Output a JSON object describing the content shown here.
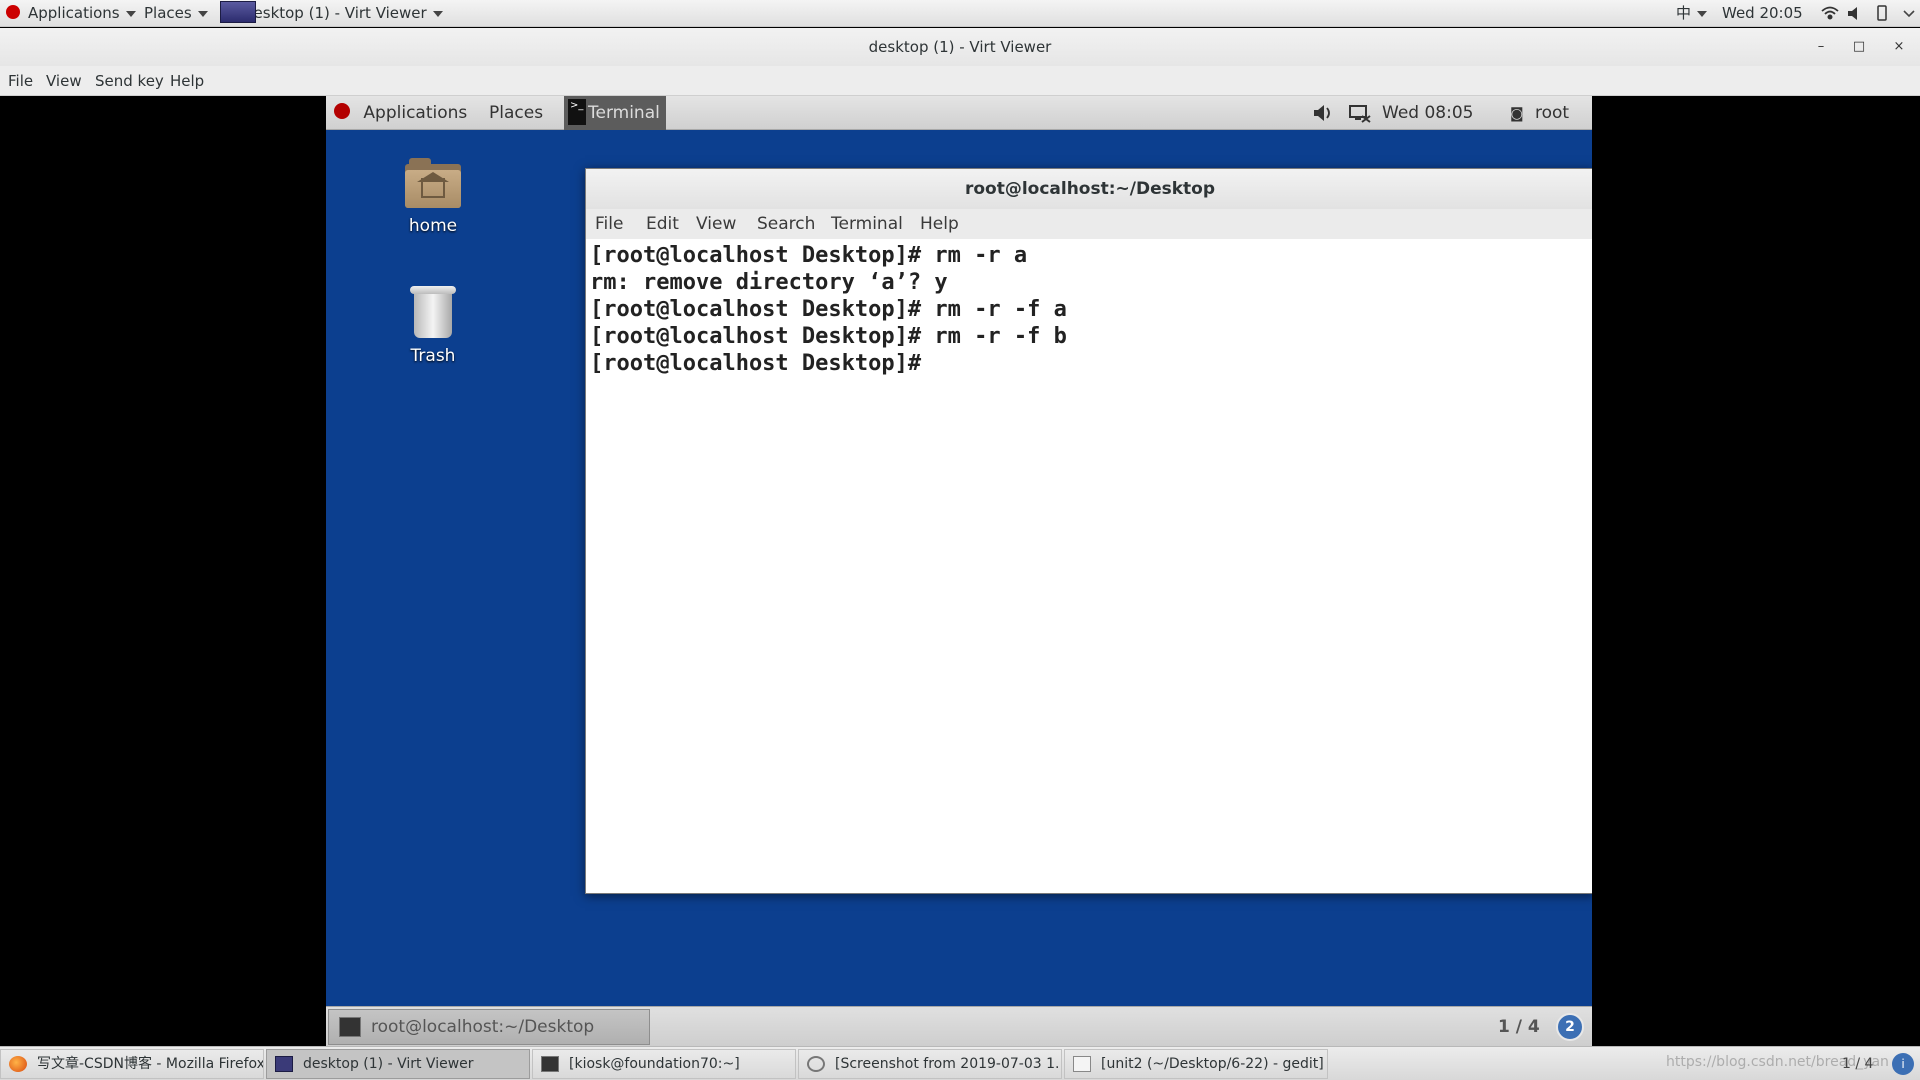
{
  "host_panel": {
    "applications": "Applications",
    "places": "Places",
    "active_window": "desktop (1) - Virt Viewer",
    "input_method": "中",
    "clock": "Wed 20:05"
  },
  "window": {
    "title": "desktop (1) - Virt Viewer",
    "minimize": "–",
    "maximize": "□",
    "close": "×",
    "menu": [
      "File",
      "View",
      "Send key",
      "Help"
    ]
  },
  "guest": {
    "panel": {
      "applications": "Applications",
      "places": "Places",
      "terminal": "Terminal",
      "clock": "Wed 08:05",
      "user": "root"
    },
    "desktop_icons": {
      "home": "home",
      "trash": "Trash"
    },
    "terminal": {
      "title": "root@localhost:~/Desktop",
      "menu": [
        "File",
        "Edit",
        "View",
        "Search",
        "Terminal",
        "Help"
      ],
      "lines": [
        "[root@localhost Desktop]# rm -r a",
        "rm: remove directory ‘a’? y",
        "[root@localhost Desktop]# rm -r -f a",
        "[root@localhost Desktop]# rm -r -f b",
        "[root@localhost Desktop]# "
      ]
    },
    "bottom": {
      "task": "root@localhost:~/Desktop",
      "workspace": "1 / 4",
      "notifications": "2"
    }
  },
  "host_taskbar": {
    "tasks": [
      "写文章-CSDN博客 - Mozilla Firefox",
      "desktop (1) - Virt Viewer",
      "[kiosk@foundation70:~]",
      "[Screenshot from 2019-07-03 1...",
      "[unit2 (~/Desktop/6-22) - gedit]"
    ],
    "workspace": "1 / 4",
    "watermark": "https://blog.csdn.net/bread_yan",
    "colors": {
      "accent": "#3c6fb4",
      "guest_bg": "#0c3f8f"
    }
  }
}
